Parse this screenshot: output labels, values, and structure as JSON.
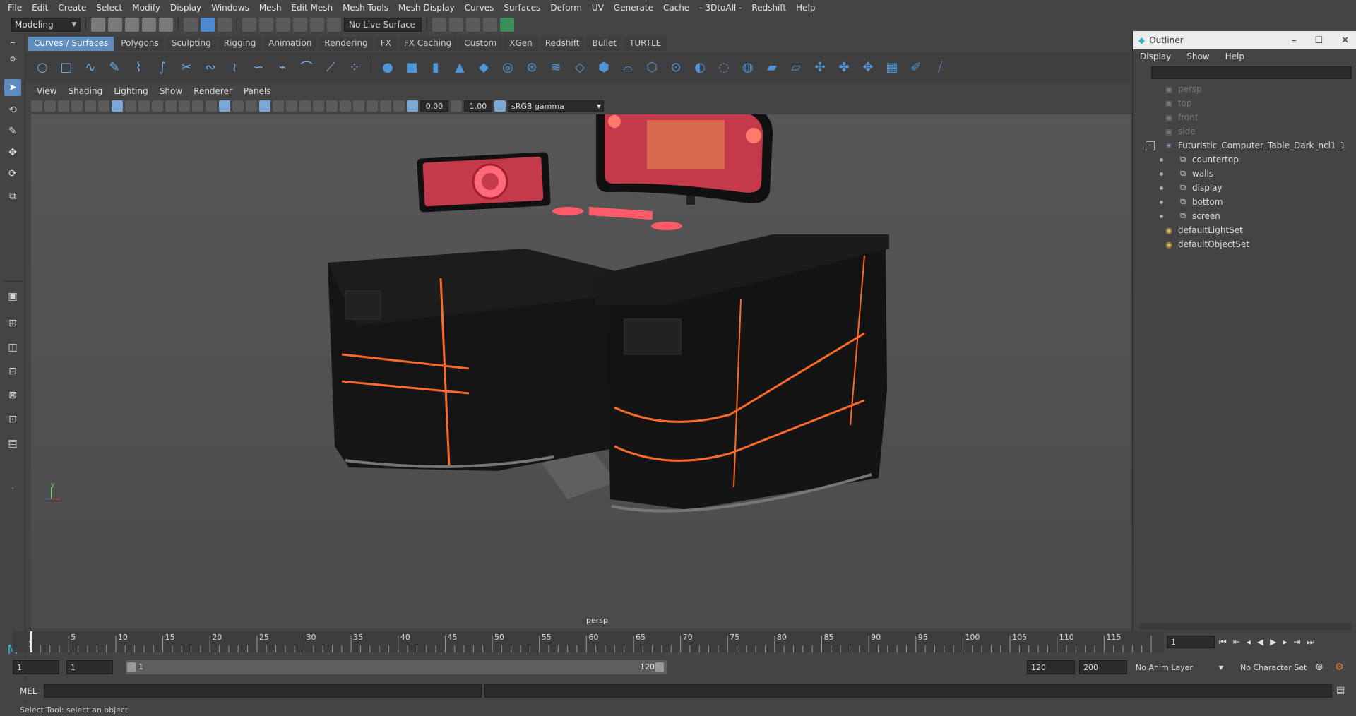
{
  "menu": [
    "File",
    "Edit",
    "Create",
    "Select",
    "Modify",
    "Display",
    "Windows",
    "Mesh",
    "Edit Mesh",
    "Mesh Tools",
    "Mesh Display",
    "Curves",
    "Surfaces",
    "Deform",
    "UV",
    "Generate",
    "Cache",
    "- 3DtoAll -",
    "Redshift",
    "Help"
  ],
  "statusline": {
    "mode": "Modeling",
    "live_surface": "No Live Surface"
  },
  "shelf_tabs": [
    "Curves / Surfaces",
    "Polygons",
    "Sculpting",
    "Rigging",
    "Animation",
    "Rendering",
    "FX",
    "FX Caching",
    "Custom",
    "XGen",
    "Redshift",
    "Bullet",
    "TURTLE"
  ],
  "shelf_active_tab": "Curves / Surfaces",
  "panel_menu": [
    "View",
    "Shading",
    "Lighting",
    "Show",
    "Renderer",
    "Panels"
  ],
  "viewport": {
    "near_value": "0.00",
    "gamma_value": "1.00",
    "color_space": "sRGB gamma",
    "camera_label": "persp"
  },
  "outliner": {
    "title": "Outliner",
    "menu": [
      "Display",
      "Show",
      "Help"
    ],
    "cameras": [
      "persp",
      "top",
      "front",
      "side"
    ],
    "group": "Futuristic_Computer_Table_Dark_ncl1_1",
    "children": [
      "countertop",
      "walls",
      "display",
      "bottom",
      "screen"
    ],
    "sets": [
      "defaultLightSet",
      "defaultObjectSet"
    ]
  },
  "timeline": {
    "ticks": [
      "5",
      "10",
      "15",
      "20",
      "25",
      "30",
      "35",
      "40",
      "45",
      "50",
      "55",
      "60",
      "65",
      "70",
      "75",
      "80",
      "85",
      "90",
      "95",
      "100",
      "105",
      "110",
      "115"
    ],
    "start_label": "1",
    "current_frame": "1"
  },
  "range": {
    "start": "1",
    "playback_start": "1",
    "slider_start": "1",
    "slider_end": "120",
    "playback_end": "120",
    "end": "200",
    "anim_layer": "No Anim Layer",
    "character_set": "No Character Set"
  },
  "command_line": {
    "lang": "MEL"
  },
  "help_line": "Select Tool: select an object"
}
